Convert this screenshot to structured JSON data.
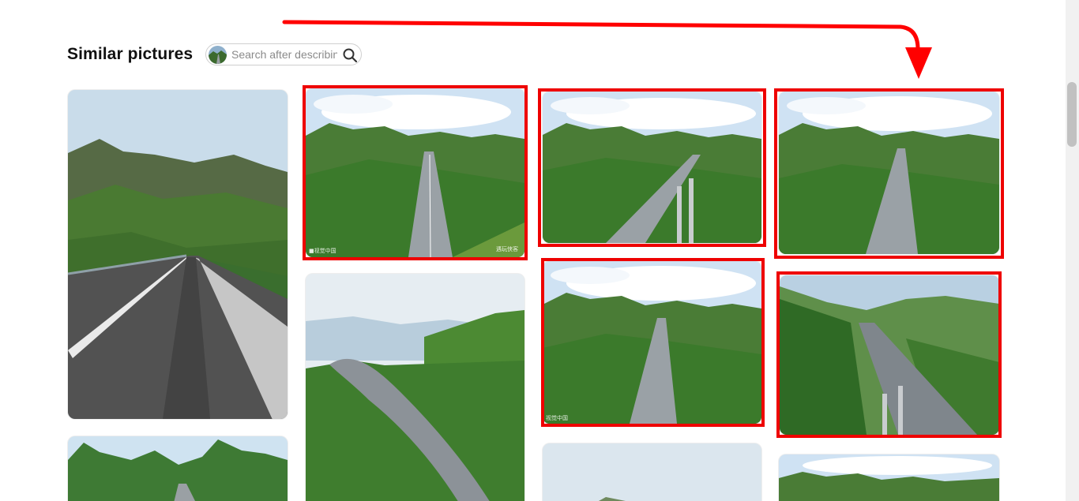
{
  "section": {
    "title": "Similar pictures"
  },
  "search": {
    "placeholder": "Search after describing"
  },
  "watermarks": {
    "w1_left": "■视觉中国",
    "w1_right": "遇玩侠客",
    "w4_left": "视觉中国"
  },
  "colors": {
    "highlight": "#ee0000",
    "arrow": "#ff0000",
    "sky": "#cfe2f3",
    "hills": "#3f7a2a",
    "road": "#8e9499"
  }
}
